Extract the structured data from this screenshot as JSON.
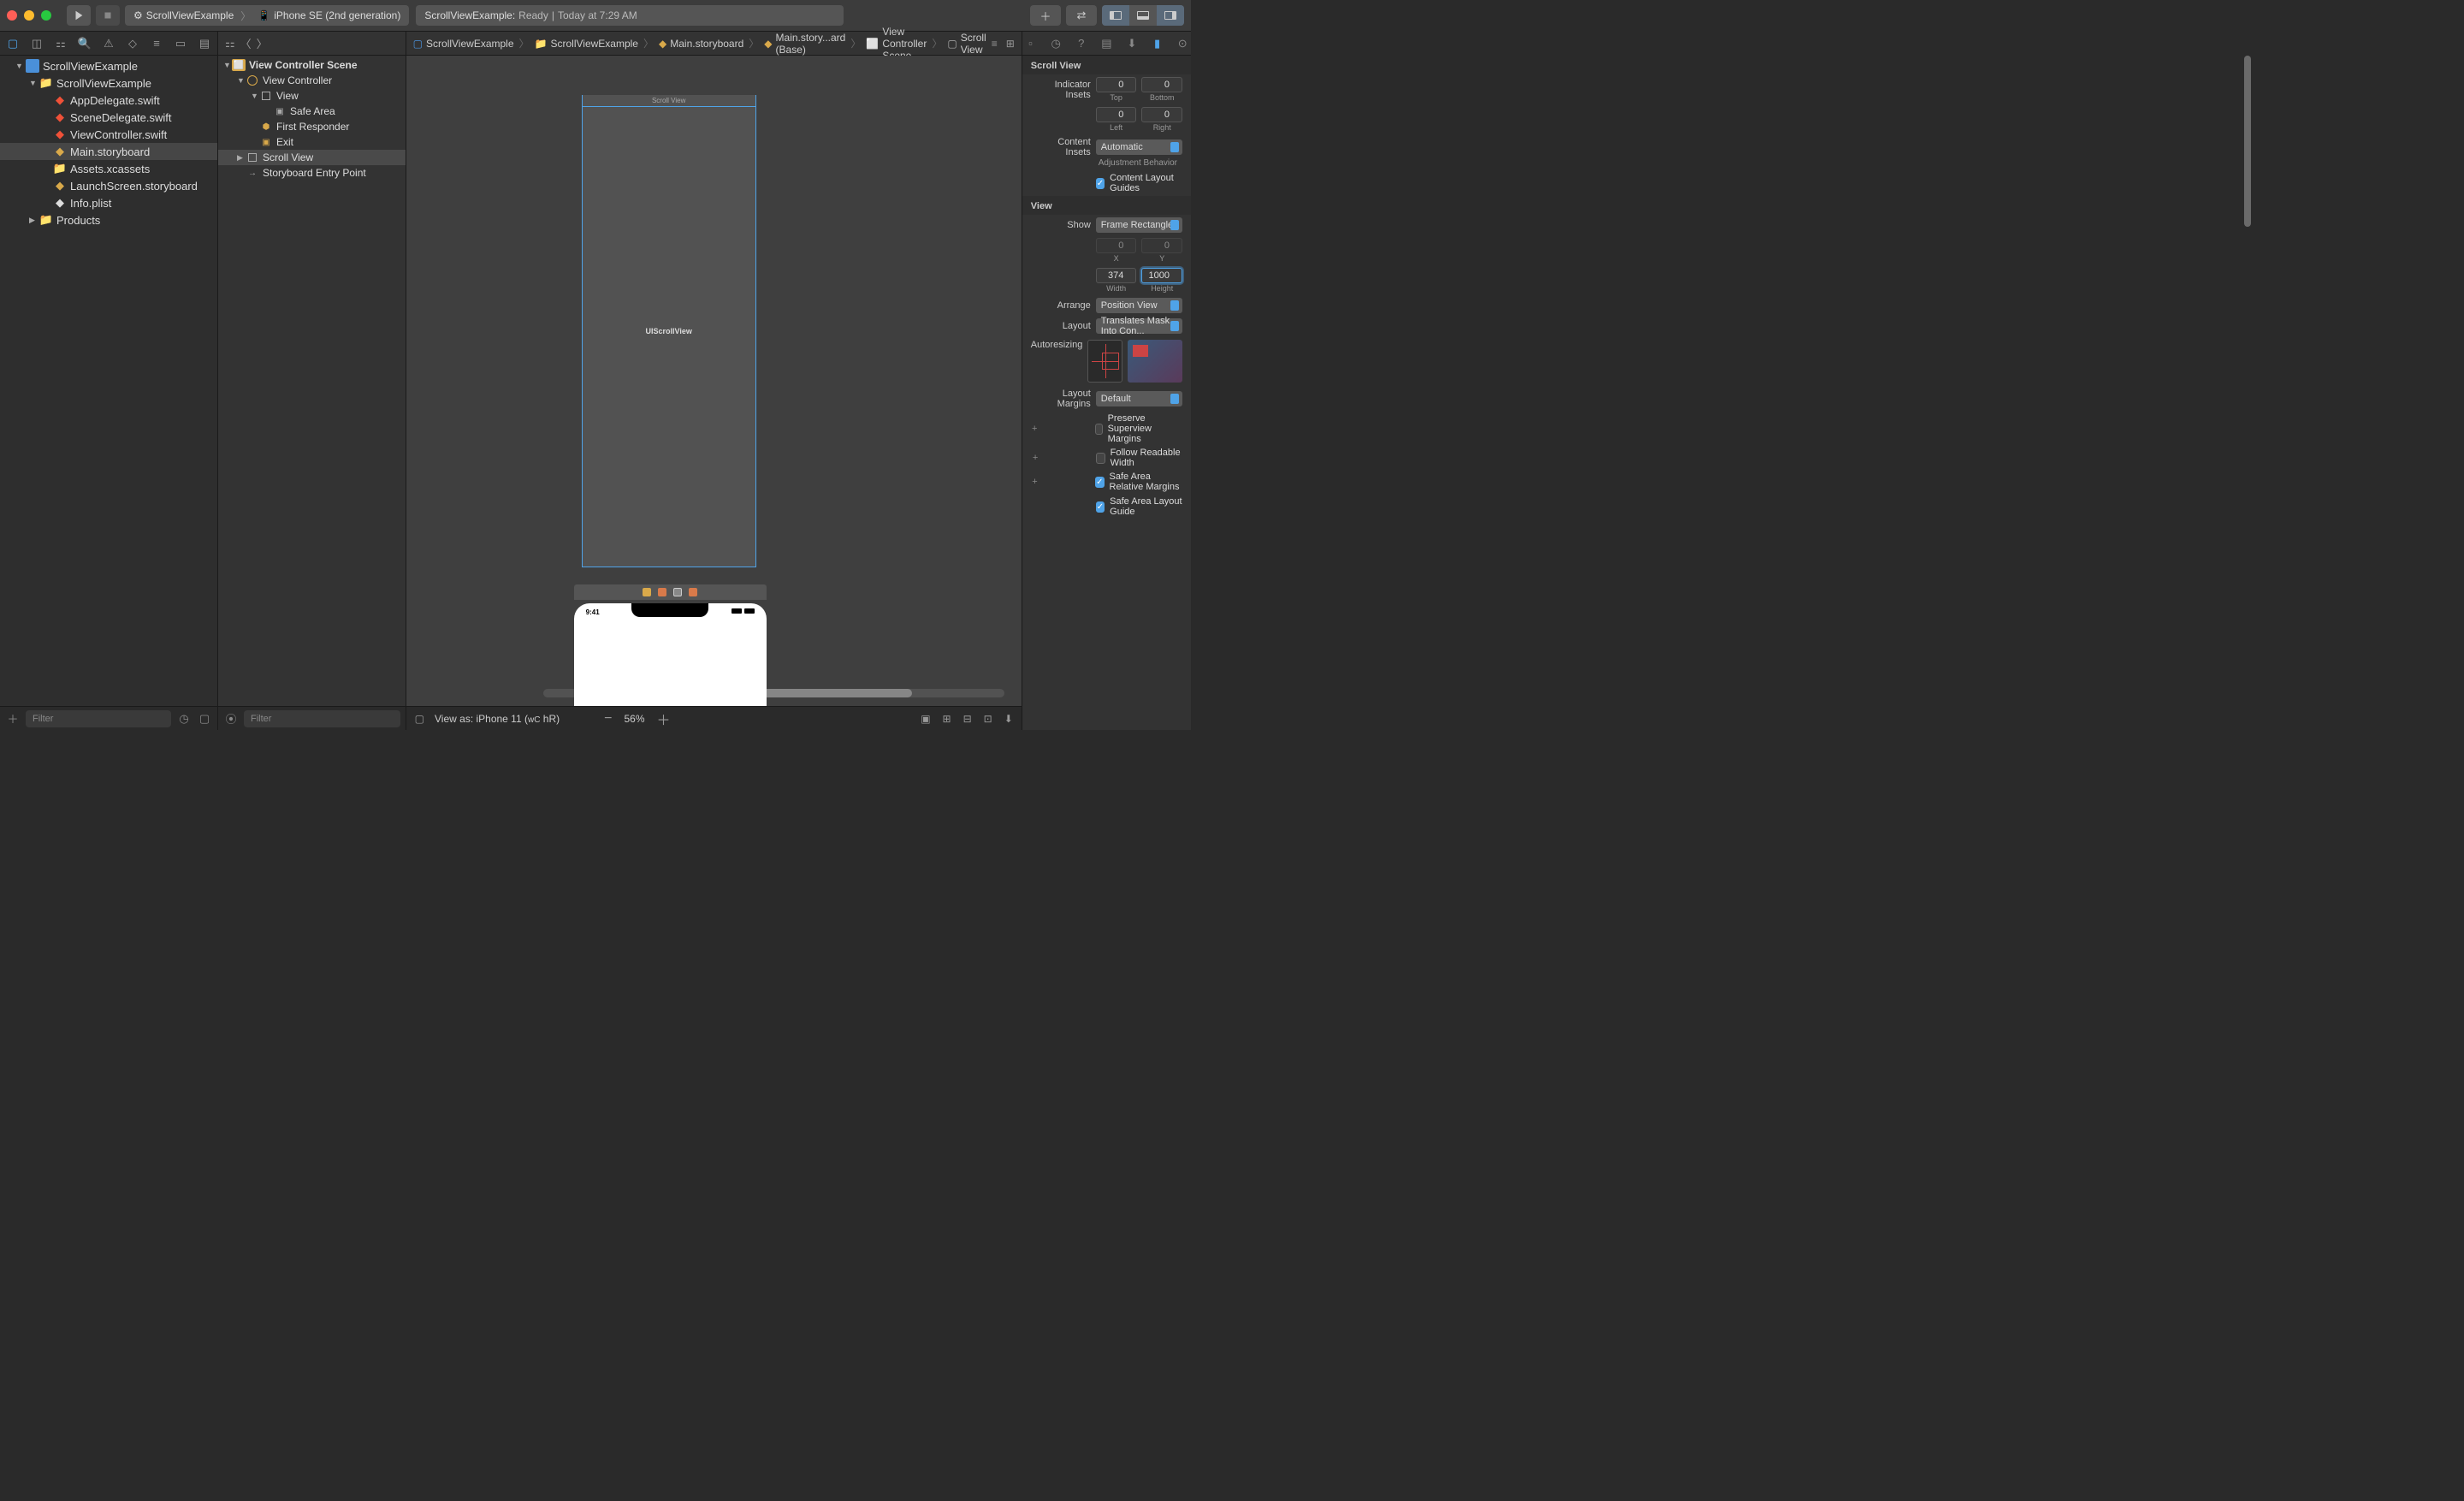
{
  "titlebar": {
    "scheme": {
      "app": "ScrollViewExample",
      "device": "iPhone SE (2nd generation)"
    },
    "status": {
      "project": "ScrollViewExample:",
      "state": "Ready",
      "time": "Today at 7:29 AM"
    }
  },
  "navigator": {
    "project": "ScrollViewExample",
    "folder": "ScrollViewExample",
    "files": {
      "appdelegate": "AppDelegate.swift",
      "scenedelegate": "SceneDelegate.swift",
      "viewcontroller": "ViewController.swift",
      "mainstory": "Main.storyboard",
      "assets": "Assets.xcassets",
      "launch": "LaunchScreen.storyboard",
      "info": "Info.plist"
    },
    "products": "Products",
    "filter_placeholder": "Filter"
  },
  "outline": {
    "scene": "View Controller Scene",
    "vc": "View Controller",
    "view": "View",
    "safearea": "Safe Area",
    "firstresponder": "First Responder",
    "exit": "Exit",
    "scrollview": "Scroll View",
    "entry": "Storyboard Entry Point",
    "filter_placeholder": "Filter"
  },
  "jumpbar": {
    "item1": "ScrollViewExample",
    "item2": "ScrollViewExample",
    "item3": "Main.storyboard",
    "item4": "Main.story...ard (Base)",
    "item5": "View Controller Scene",
    "item6": "Scroll View"
  },
  "canvas": {
    "scrollview_title": "Scroll View",
    "scrollview_center": "UIScrollView",
    "phone_time": "9:41"
  },
  "bottom": {
    "viewas": "View as: iPhone 11 (",
    "wc": "wC",
    "hr": "hR",
    "close": ")",
    "zoom": "56%"
  },
  "inspector": {
    "scrollview_title": "Scroll View",
    "indicator_insets_label": "Indicator Insets",
    "top_label": "Top",
    "bottom_label": "Bottom",
    "left_label": "Left",
    "right_label": "Right",
    "inset_top": "0",
    "inset_bottom": "0",
    "inset_left": "0",
    "inset_right": "0",
    "content_insets_label": "Content Insets",
    "content_insets_value": "Automatic",
    "adjustment_label": "Adjustment Behavior",
    "content_layout_guides": "Content Layout Guides",
    "view_title": "View",
    "show_label": "Show",
    "show_value": "Frame Rectangle",
    "x_label": "X",
    "y_label": "Y",
    "width_label": "Width",
    "height_label": "Height",
    "x_val": "0",
    "y_val": "0",
    "width_val": "374",
    "height_val": "1000",
    "arrange_label": "Arrange",
    "arrange_value": "Position View",
    "layout_label": "Layout",
    "layout_value": "Translates Mask Into Con...",
    "autoresizing_label": "Autoresizing",
    "layout_margins_label": "Layout Margins",
    "layout_margins_value": "Default",
    "preserve_superview": "Preserve Superview Margins",
    "follow_readable": "Follow Readable Width",
    "safe_relative": "Safe Area Relative Margins",
    "safe_guide": "Safe Area Layout Guide"
  }
}
